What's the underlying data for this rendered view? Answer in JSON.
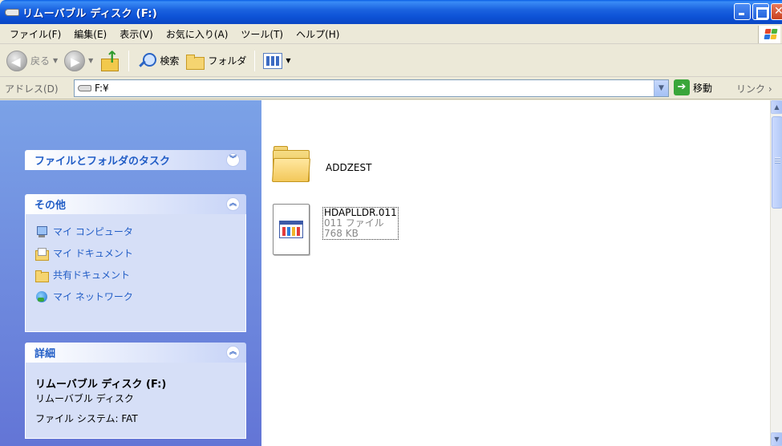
{
  "window": {
    "title": "リムーバブル ディスク (F:)"
  },
  "menu": [
    "ファイル(F)",
    "編集(E)",
    "表示(V)",
    "お気に入り(A)",
    "ツール(T)",
    "ヘルプ(H)"
  ],
  "toolbar": {
    "back_label": "戻る",
    "search_label": "検索",
    "folders_label": "フォルダ"
  },
  "address": {
    "label": "アドレス(D)",
    "value": "F:¥",
    "go_label": "移動",
    "links_label": "リンク"
  },
  "left_panel": {
    "tasks_title": "ファイルとフォルダのタスク",
    "other_title": "その他",
    "other_links": [
      "マイ コンピュータ",
      "マイ ドキュメント",
      "共有ドキュメント",
      "マイ ネットワーク"
    ],
    "details_title": "詳細",
    "details_name": "リムーバブル ディスク (F:)",
    "details_type": "リムーバブル ディスク",
    "details_fs": "ファイル システム: FAT"
  },
  "content": {
    "folder_name": "ADDZEST",
    "file": {
      "name": "HDAPLLDR.011",
      "type": "011 ファイル",
      "size": "768 KB"
    }
  }
}
